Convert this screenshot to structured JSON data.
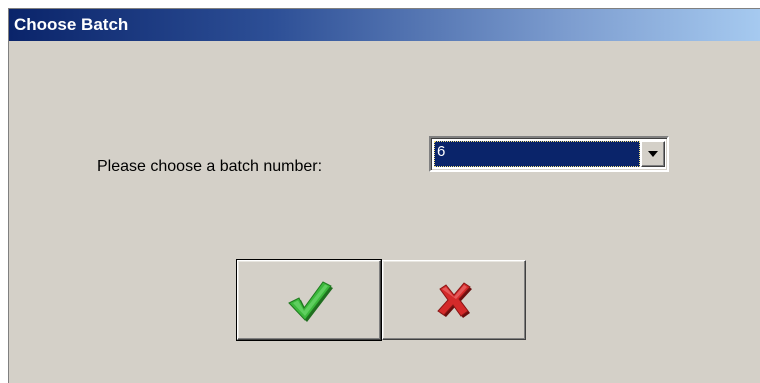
{
  "window": {
    "title": "Choose Batch"
  },
  "form": {
    "prompt_label": "Please choose a batch number:",
    "batch_select": {
      "selected_value": "6"
    }
  },
  "buttons": {
    "ok": {
      "icon": "checkmark-icon",
      "color": "#2ea02e"
    },
    "cancel": {
      "icon": "x-cross-icon",
      "color": "#c81e1e"
    }
  },
  "colors": {
    "titlebar_start": "#0a246a",
    "titlebar_end": "#a6caf0",
    "dialog_bg": "#d4d0c8",
    "selection_bg": "#0a246a"
  }
}
